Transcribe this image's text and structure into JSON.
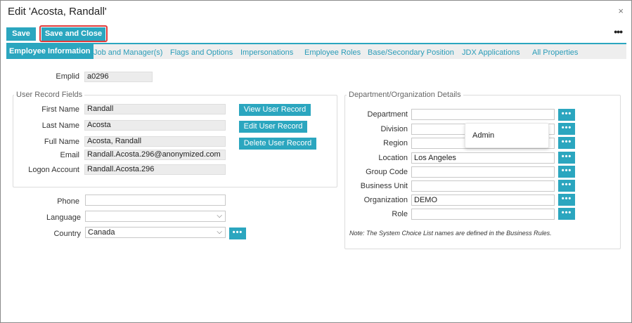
{
  "dialog": {
    "title": "Edit 'Acosta, Randall'",
    "close_glyph": "×",
    "more_glyph": "•••"
  },
  "toolbar": {
    "save_label": "Save",
    "save_close_label": "Save and Close"
  },
  "tabs": [
    {
      "label": "Employee Information",
      "active": true
    },
    {
      "label": "Job and Manager(s)"
    },
    {
      "label": "Flags and Options"
    },
    {
      "label": "Impersonations"
    },
    {
      "label": "Employee Roles"
    },
    {
      "label": "Base/Secondary Position"
    },
    {
      "label": "JDX Applications"
    },
    {
      "label": "All Properties"
    }
  ],
  "emplid": {
    "label": "Emplid",
    "value": "a0296"
  },
  "user_record": {
    "legend": "User Record Fields",
    "first_name": {
      "label": "First Name",
      "value": "Randall"
    },
    "last_name": {
      "label": "Last Name",
      "value": "Acosta"
    },
    "full_name": {
      "label": "Full Name",
      "value": "Acosta, Randall"
    },
    "email": {
      "label": "Email",
      "value": "Randall.Acosta.296@anonymized.com"
    },
    "logon": {
      "label": "Logon Account",
      "value": "Randall.Acosta.296"
    },
    "view_button": "View User Record",
    "edit_button": "Edit User Record",
    "delete_button": "Delete User Record"
  },
  "contact": {
    "phone": {
      "label": "Phone",
      "value": ""
    },
    "language": {
      "label": "Language",
      "value": ""
    },
    "country": {
      "label": "Country",
      "value": "Canada"
    }
  },
  "dept": {
    "legend": "Department/Organization Details",
    "fields": [
      {
        "label": "Department",
        "value": ""
      },
      {
        "label": "Division",
        "value": ""
      },
      {
        "label": "Region",
        "value": ""
      },
      {
        "label": "Location",
        "value": "Los Angeles"
      },
      {
        "label": "Group Code",
        "value": ""
      },
      {
        "label": "Business Unit",
        "value": ""
      },
      {
        "label": "Organization",
        "value": "DEMO"
      },
      {
        "label": "Role",
        "value": ""
      }
    ],
    "note": "Note: The System Choice List names are defined in the Business Rules."
  },
  "dropdown": {
    "option": "Admin"
  },
  "picker_glyph": "•••",
  "chevron_glyph": "⌵",
  "colors": {
    "accent": "#2ba6bf",
    "highlight": "#e03a3a"
  }
}
